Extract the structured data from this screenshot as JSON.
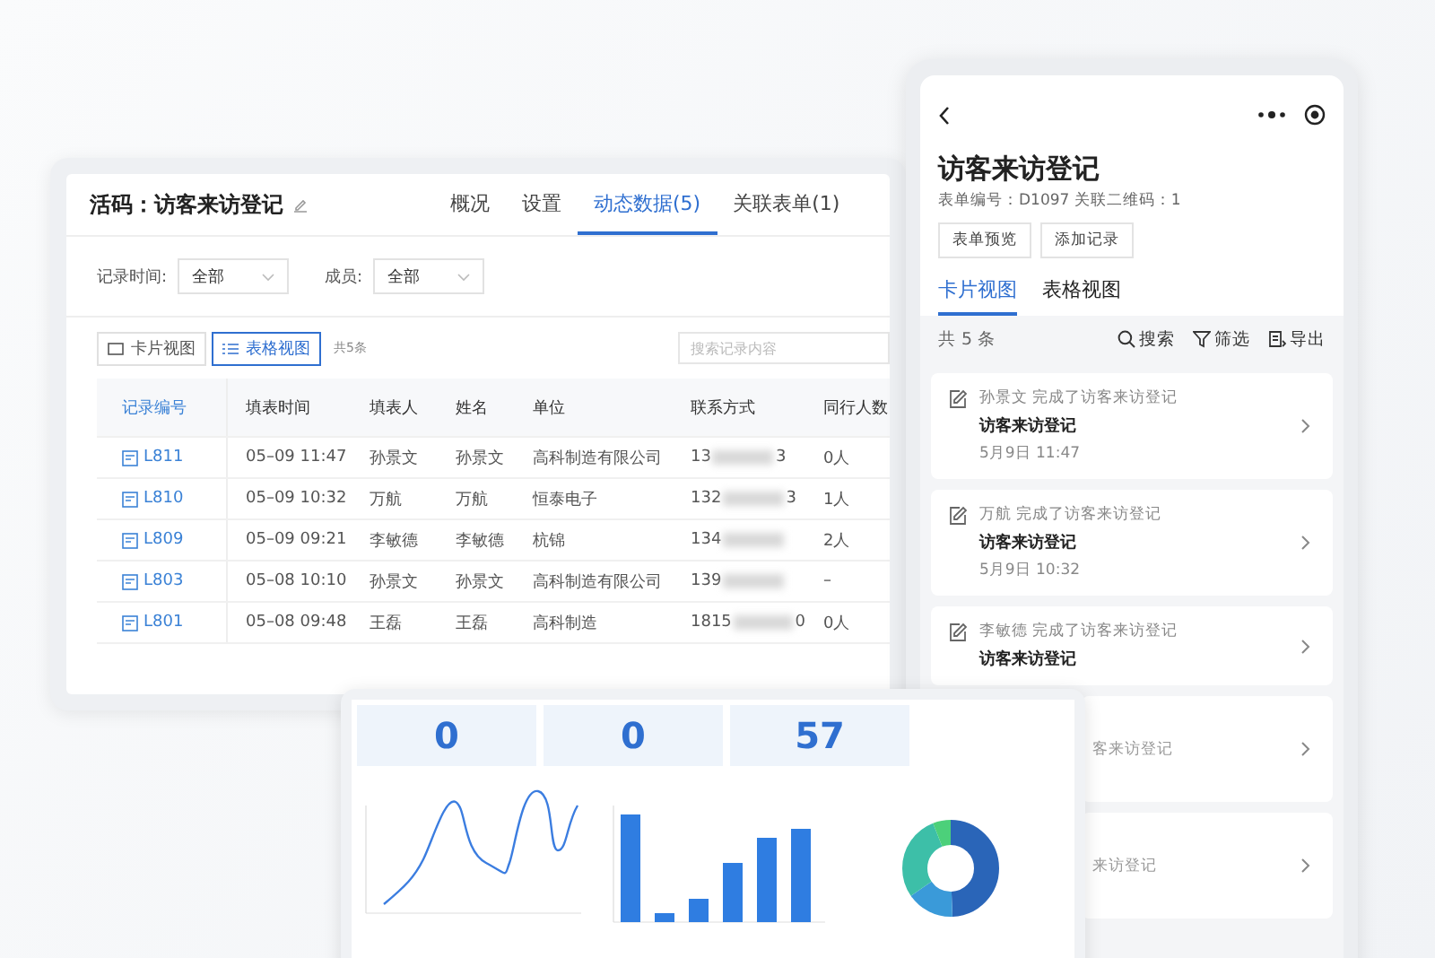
{
  "web_panel": {
    "title": "活码：访客来访登记",
    "tabs": [
      {
        "label": "概况",
        "selected": false
      },
      {
        "label": "设置",
        "selected": false
      },
      {
        "label": "动态数据(5)",
        "selected": true
      },
      {
        "label": "关联表单(1)",
        "selected": false
      }
    ],
    "filters": [
      {
        "label": "记录时间:",
        "value": "全部"
      },
      {
        "label": "成员:",
        "value": "全部"
      }
    ],
    "views": [
      {
        "label": "卡片视图",
        "kind": "card",
        "selected": false
      },
      {
        "label": "表格视图",
        "kind": "table",
        "selected": true
      }
    ],
    "count": "共5条",
    "search": {
      "placeholder": "搜索记录内容"
    },
    "table": {
      "columns": [
        "记录编号",
        "填表时间",
        "填表人",
        "姓名",
        "单位",
        "联系方式",
        "同行人数"
      ],
      "rows": [
        {
          "id": "L811",
          "time": "05–09 11:47",
          "filler": "孙景文",
          "name": "孙景文",
          "org": "高科制造有限公司",
          "contact_start": "13",
          "contact_end": "3",
          "companions": "0人"
        },
        {
          "id": "L810",
          "time": "05–09 10:32",
          "filler": "万航",
          "name": "万航",
          "org": "恒泰电子",
          "contact_start": "132",
          "contact_end": "3",
          "companions": "1人"
        },
        {
          "id": "L809",
          "time": "05–09 09:21",
          "filler": "李敏德",
          "name": "李敏德",
          "org": "杭锦",
          "contact_start": "134",
          "companions": "2人"
        },
        {
          "id": "L803",
          "time": "05–08 10:10",
          "filler": "孙景文",
          "name": "孙景文",
          "org": "高科制造有限公司",
          "contact_start": "139",
          "companions": "–"
        },
        {
          "id": "L801",
          "time": "05–08 09:48",
          "filler": "王磊",
          "name": "王磊",
          "org": "高科制造",
          "contact_start": "1815",
          "contact_end": "0",
          "companions": "0人"
        }
      ]
    }
  },
  "mobile": {
    "title": "访客来访登记",
    "meta": "表单编号：D1097  关联二维码：1",
    "buttons": [
      "表单预览",
      "添加记录"
    ],
    "tabs": [
      {
        "label": "卡片视图",
        "selected": true
      },
      {
        "label": "表格视图",
        "selected": false
      }
    ],
    "count": "共 5 条",
    "actions": [
      {
        "kind": "search",
        "label": "搜索"
      },
      {
        "kind": "filter",
        "label": "筛选"
      },
      {
        "kind": "export",
        "label": "导出"
      }
    ],
    "cards": [
      {
        "kind": "full",
        "actor": "孙景文",
        "action": "完成了访客来访登记",
        "title": "访客来访登记",
        "date": "5月9日 11:47"
      },
      {
        "kind": "full",
        "actor": "万航",
        "action": "完成了访客来访登记",
        "title": "访客来访登记",
        "date": "5月9日 10:32"
      },
      {
        "kind": "full",
        "actor": "李敏德",
        "action": "完成了访客来访登记",
        "title": "访客来访登记"
      },
      {
        "kind": "partial",
        "text": "客来访登记"
      },
      {
        "kind": "partial",
        "text": "来访登记"
      }
    ]
  },
  "dashboard": {
    "stats": [
      "0",
      "0",
      "57"
    ]
  }
}
